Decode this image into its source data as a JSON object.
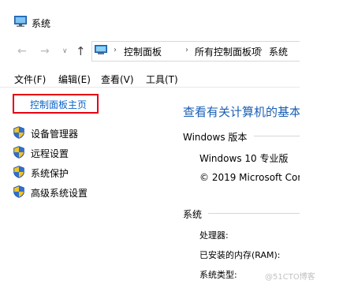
{
  "window": {
    "title": "系统",
    "icon": "computer-icon"
  },
  "nav": {
    "back_icon": "arrow-left-icon",
    "forward_icon": "arrow-right-icon",
    "recent_icon": "chevron-down-icon",
    "up_icon": "arrow-up-icon",
    "separator": "›",
    "breadcrumbs": [
      {
        "label": "控制面板"
      },
      {
        "label": "所有控制面板项"
      },
      {
        "label": "系统"
      }
    ]
  },
  "menu": {
    "file": "文件(F)",
    "edit": "编辑(E)",
    "view": "查看(V)",
    "tools": "工具(T)"
  },
  "sidebar": {
    "home_link": "控制面板主页",
    "items": [
      {
        "label": "设备管理器",
        "icon": "shield-icon"
      },
      {
        "label": "远程设置",
        "icon": "shield-icon"
      },
      {
        "label": "系统保护",
        "icon": "shield-icon"
      },
      {
        "label": "高级系统设置",
        "icon": "shield-icon"
      }
    ]
  },
  "main": {
    "heading": "查看有关计算机的基本",
    "windows_edition": {
      "title": "Windows 版本",
      "version": "Windows 10 专业版",
      "copyright": "© 2019 Microsoft Cor"
    },
    "system": {
      "title": "系统",
      "rows": [
        {
          "label": "处理器:"
        },
        {
          "label": "已安装的内存(RAM):"
        },
        {
          "label": "系统类型:"
        }
      ]
    }
  },
  "watermark": "@51CTO博客",
  "colors": {
    "link": "#0a64c8",
    "heading": "#1a5fb4",
    "highlight_border": "#e60012"
  }
}
